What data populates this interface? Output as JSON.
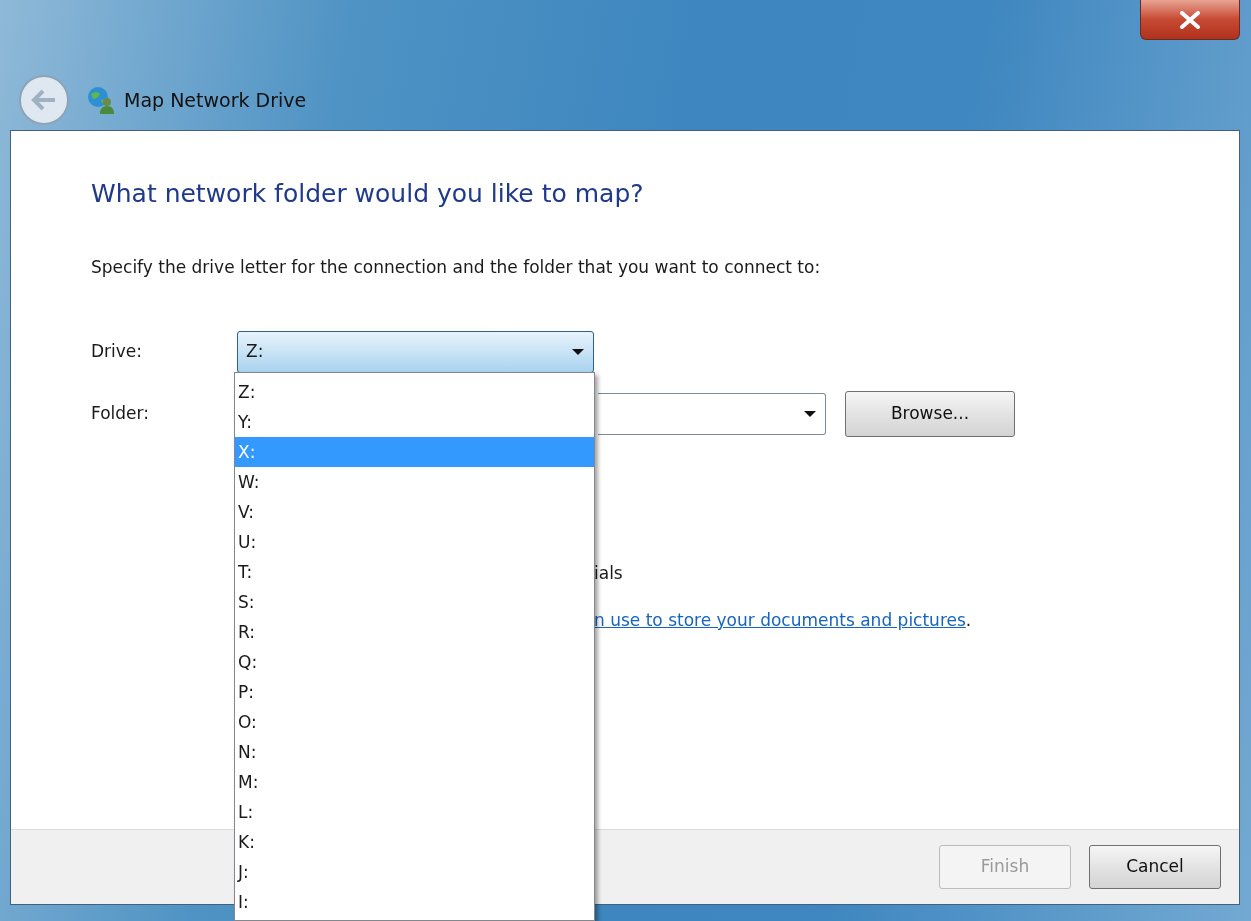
{
  "window": {
    "title": "Map Network Drive"
  },
  "heading": "What network folder would you like to map?",
  "instruction": "Specify the drive letter for the connection and the folder that you want to connect to:",
  "drive": {
    "label": "Drive:",
    "value": "Z:",
    "expanded": true
  },
  "folder": {
    "label": "Folder:"
  },
  "browse_button": "Browse...",
  "hidden_fragments": {
    "option_text": "ials",
    "link_text": "n use to store your documents and pictures",
    "link_suffix": "."
  },
  "drive_list": [
    {
      "label": "Z:",
      "selected": false
    },
    {
      "label": "Y:",
      "selected": false
    },
    {
      "label": "X:",
      "selected": true
    },
    {
      "label": "W:",
      "selected": false
    },
    {
      "label": "V:",
      "selected": false
    },
    {
      "label": "U:",
      "selected": false
    },
    {
      "label": "T:",
      "selected": false
    },
    {
      "label": "S:",
      "selected": false
    },
    {
      "label": "R:",
      "selected": false
    },
    {
      "label": "Q:",
      "selected": false
    },
    {
      "label": "P:",
      "selected": false
    },
    {
      "label": "O:",
      "selected": false
    },
    {
      "label": "N:",
      "selected": false
    },
    {
      "label": "M:",
      "selected": false
    },
    {
      "label": "L:",
      "selected": false
    },
    {
      "label": "K:",
      "selected": false
    },
    {
      "label": "J:",
      "selected": false
    },
    {
      "label": "I:",
      "selected": false
    }
  ],
  "buttons": [
    {
      "label": "Finish",
      "disabled": true
    },
    {
      "label": "Cancel",
      "disabled": false
    }
  ]
}
